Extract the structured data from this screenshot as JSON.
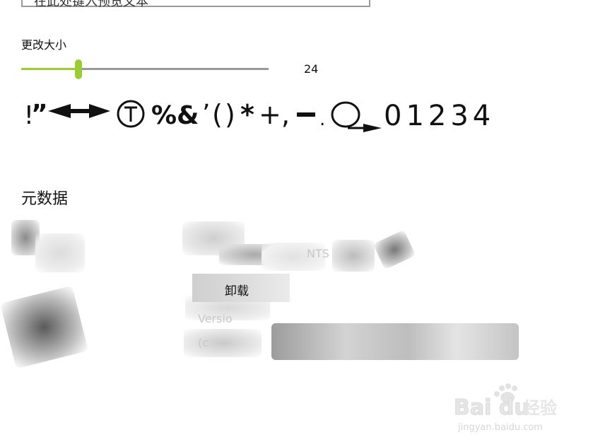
{
  "top_input": {
    "value": "在此处键入预览文本"
  },
  "resize": {
    "label": "更改大小",
    "value": "24",
    "min": 1,
    "max": 100,
    "current": 24,
    "accent": "#9acd32",
    "track_color": "#999999"
  },
  "preview": {
    "symbols": [
      "!",
      "”",
      "*",
      "+",
      ",",
      "-",
      ".",
      "%",
      "&",
      "’",
      "(",
      ")"
    ],
    "digits": "01234"
  },
  "metadata": {
    "title": "元数据",
    "uninstall_label": "卸载",
    "faint_rows": [
      "NTS",
      "Versio",
      "(c"
    ]
  },
  "watermark": {
    "brand": "Bai du",
    "product": "经验",
    "url": "jingyan.baidu.com"
  }
}
